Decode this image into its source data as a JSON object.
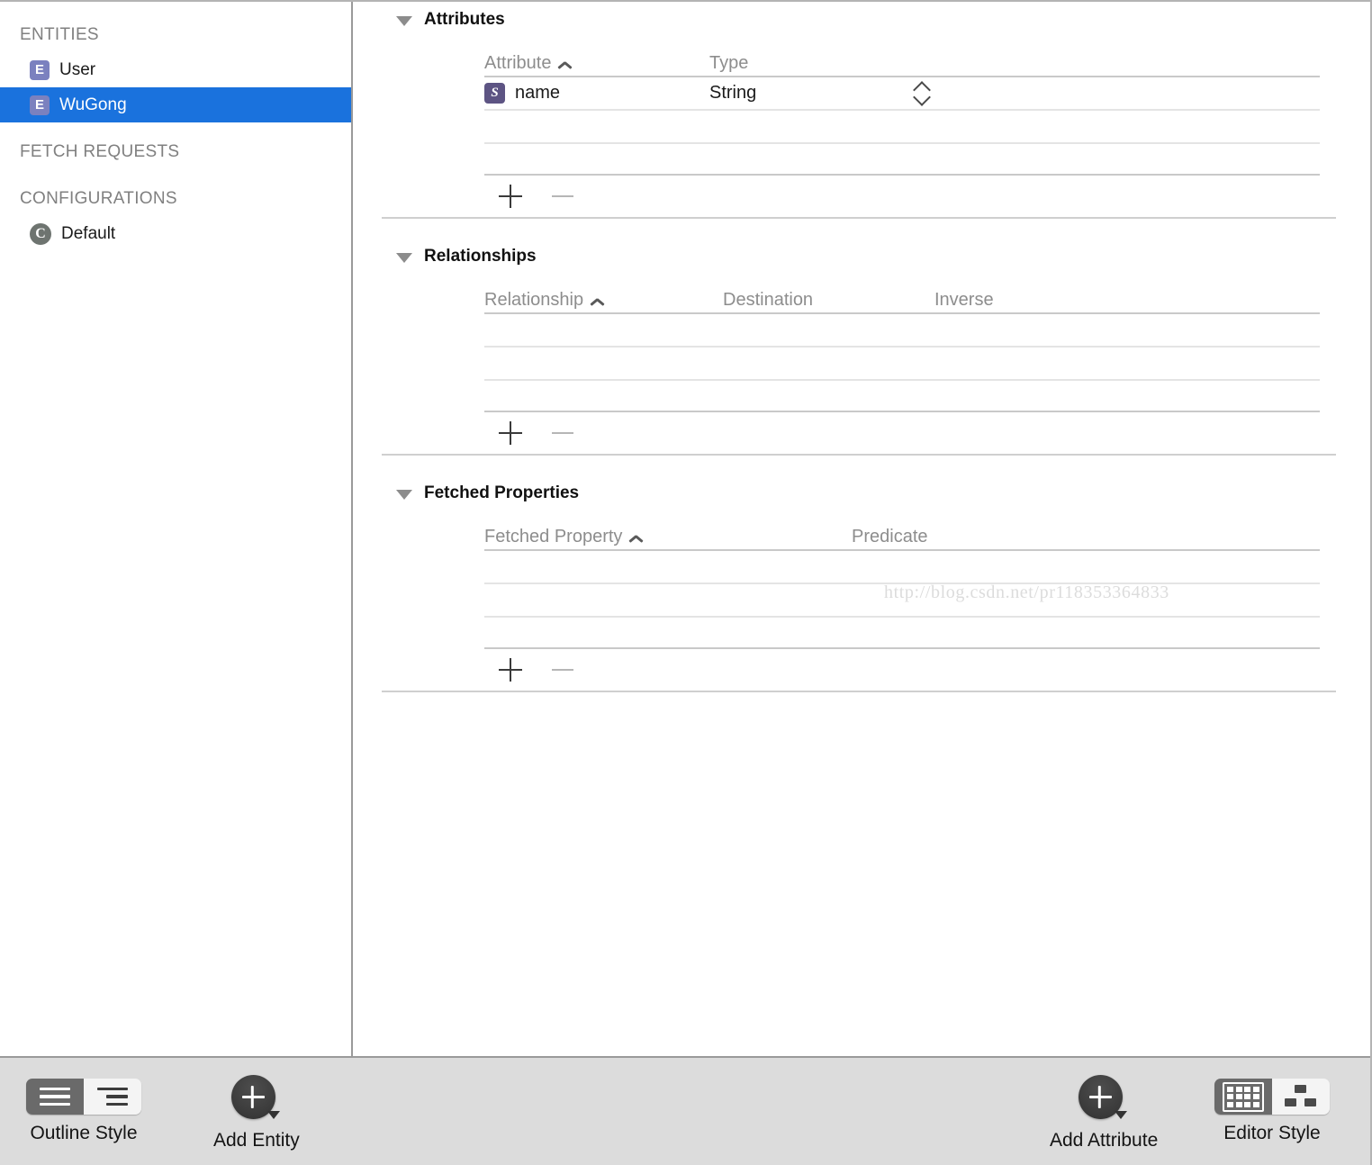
{
  "sidebar": {
    "groups": [
      {
        "header": "ENTITIES",
        "items": [
          {
            "icon": "entity-icon",
            "icon_letter": "E",
            "label": "User",
            "selected": false
          },
          {
            "icon": "entity-icon",
            "icon_letter": "E",
            "label": "WuGong",
            "selected": true
          }
        ]
      },
      {
        "header": "FETCH REQUESTS",
        "items": []
      },
      {
        "header": "CONFIGURATIONS",
        "items": [
          {
            "icon": "configuration-icon",
            "icon_letter": "C",
            "label": "Default",
            "selected": false
          }
        ]
      }
    ]
  },
  "editor": {
    "sections": [
      {
        "title": "Attributes",
        "disclosure": "triangle-down-icon",
        "columns": [
          "Attribute",
          "Type"
        ],
        "sorted_column": "Attribute",
        "sort_direction": "ascending",
        "rows": [
          {
            "icon_letter": "S",
            "icon": "string-type-icon",
            "name": "name",
            "type": "String"
          }
        ],
        "empty_rows": 2,
        "add_label": "+",
        "remove_label": "−",
        "remove_enabled": false
      },
      {
        "title": "Relationships",
        "disclosure": "triangle-down-icon",
        "columns": [
          "Relationship",
          "Destination",
          "Inverse"
        ],
        "sorted_column": "Relationship",
        "sort_direction": "ascending",
        "rows": [],
        "empty_rows": 3,
        "add_label": "+",
        "remove_label": "−",
        "remove_enabled": false
      },
      {
        "title": "Fetched Properties",
        "disclosure": "triangle-down-icon",
        "columns": [
          "Fetched Property",
          "Predicate"
        ],
        "sorted_column": "Fetched Property",
        "sort_direction": "ascending",
        "rows": [],
        "empty_rows": 3,
        "add_label": "+",
        "remove_label": "−",
        "remove_enabled": false
      }
    ],
    "watermark": "http://blog.csdn.net/pr118353364833"
  },
  "toolbar": {
    "outline_style": {
      "label": "Outline Style",
      "segments": [
        {
          "icon": "flat-list-icon",
          "selected": true
        },
        {
          "icon": "indented-list-icon",
          "selected": false
        }
      ]
    },
    "add_entity": {
      "label": "Add Entity",
      "icon": "plus-circle-icon",
      "has_menu": true
    },
    "add_attribute": {
      "label": "Add Attribute",
      "icon": "plus-circle-icon",
      "has_menu": true
    },
    "editor_style": {
      "label": "Editor Style",
      "segments": [
        {
          "icon": "table-grid-icon",
          "selected": true
        },
        {
          "icon": "graph-nodes-icon",
          "selected": false
        }
      ]
    }
  },
  "colors": {
    "selection_blue": "#1a72dd",
    "entity_icon": "#7b81bf",
    "attribute_icon": "#5d5483",
    "toolbar_bg": "#dcdcdc",
    "segment_on": "#6a6a6a"
  }
}
